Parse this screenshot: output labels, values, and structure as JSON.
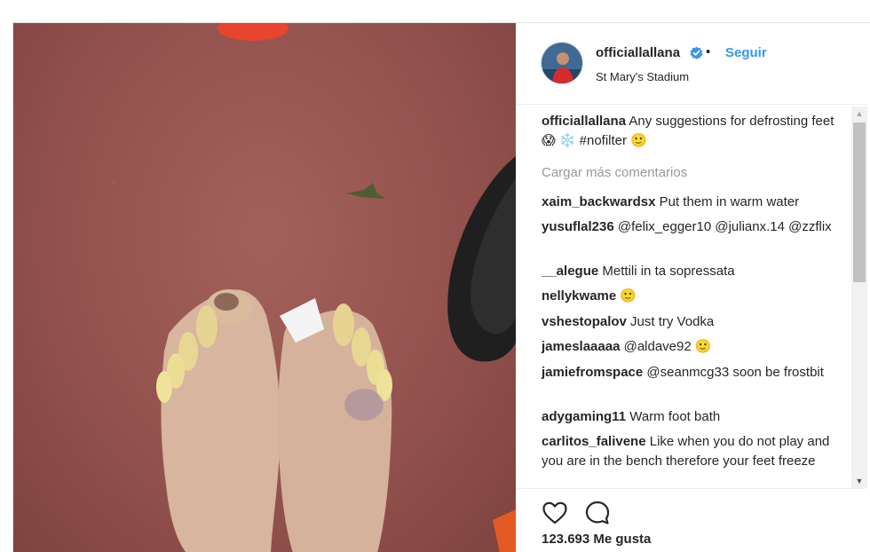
{
  "post": {
    "username": "officiallallana",
    "dot": "•",
    "follow_label": "Seguir",
    "location": "St Mary's Stadium",
    "caption_user": "officiallallana",
    "caption_text": "Any suggestions for defrosting feet 😱 ❄️ #nofilter 🙂",
    "load_more": "Cargar más comentarios",
    "likes": "123.693 Me gusta"
  },
  "comments": [
    {
      "user": "xaim_backwardsx",
      "text": "Put them in warm water"
    },
    {
      "user": "yusuflal236",
      "text": "@felix_egger10 @julianx.14 @zzflix"
    },
    {
      "user": "__alegue",
      "text": "Mettili in ta sopressata"
    },
    {
      "user": "nellykwame",
      "text": "🙂"
    },
    {
      "user": "vshestopalov",
      "text": "Just try Vodka"
    },
    {
      "user": "jameslaaaaa",
      "text": "@aldave92 🙂"
    },
    {
      "user": "jamiefromspace",
      "text": "@seanmcg33 soon be frostbit"
    },
    {
      "user": "adygaming11",
      "text": "Warm foot bath"
    },
    {
      "user": "carlitos_falivene",
      "text": "Like when you do not play and you are in the bench therefore your feet freeze"
    }
  ],
  "icons": {
    "verified": "verified-badge-icon",
    "heart": "heart-icon",
    "comment": "comment-icon"
  },
  "colors": {
    "follow": "#3897f0",
    "verified": "#3897f0",
    "muted": "#999999",
    "text": "#262626"
  }
}
